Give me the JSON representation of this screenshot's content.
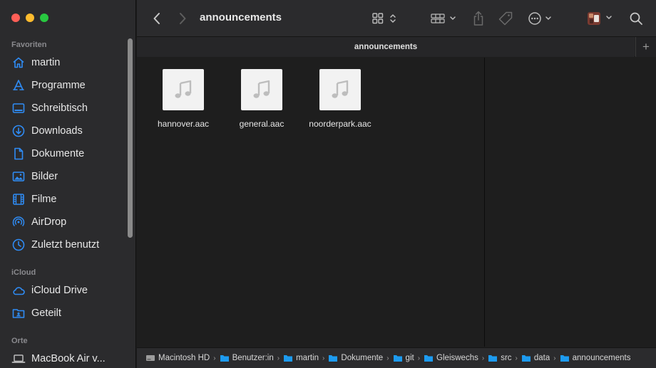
{
  "window": {
    "title": "announcements"
  },
  "sidebar": {
    "sections": {
      "favorites": "Favoriten",
      "icloud": "iCloud",
      "locations": "Orte"
    },
    "items": [
      {
        "label": "martin",
        "icon": "home-icon"
      },
      {
        "label": "Programme",
        "icon": "applications-icon"
      },
      {
        "label": "Schreibtisch",
        "icon": "desktop-icon"
      },
      {
        "label": "Downloads",
        "icon": "downloads-icon"
      },
      {
        "label": "Dokumente",
        "icon": "document-icon"
      },
      {
        "label": "Bilder",
        "icon": "pictures-icon"
      },
      {
        "label": "Filme",
        "icon": "movies-icon"
      },
      {
        "label": "AirDrop",
        "icon": "airdrop-icon"
      },
      {
        "label": "Zuletzt benutzt",
        "icon": "recents-icon"
      },
      {
        "label": "iCloud Drive",
        "icon": "cloud-icon"
      },
      {
        "label": "Geteilt",
        "icon": "shared-folder-icon"
      },
      {
        "label": "MacBook Air v...",
        "icon": "laptop-icon"
      }
    ]
  },
  "tabs": {
    "active": "announcements",
    "add": "+"
  },
  "files": [
    {
      "name": "hannover.aac"
    },
    {
      "name": "general.aac"
    },
    {
      "name": "noorderpark.aac"
    }
  ],
  "pathbar": [
    {
      "label": "Macintosh HD",
      "icon": "disk-icon"
    },
    {
      "label": "Benutzer:in",
      "icon": "folder-icon"
    },
    {
      "label": "martin",
      "icon": "folder-icon"
    },
    {
      "label": "Dokumente",
      "icon": "folder-icon"
    },
    {
      "label": "git",
      "icon": "folder-icon"
    },
    {
      "label": "Gleiswechs",
      "icon": "folder-icon"
    },
    {
      "label": "src",
      "icon": "folder-icon"
    },
    {
      "label": "data",
      "icon": "folder-icon"
    },
    {
      "label": "announcements",
      "icon": "folder-icon"
    }
  ],
  "colors": {
    "accent": "#2f8cf5",
    "folder": "#1d9bf0",
    "close": "#ff5f57",
    "minimize": "#febc2e",
    "maximize": "#28c840"
  }
}
